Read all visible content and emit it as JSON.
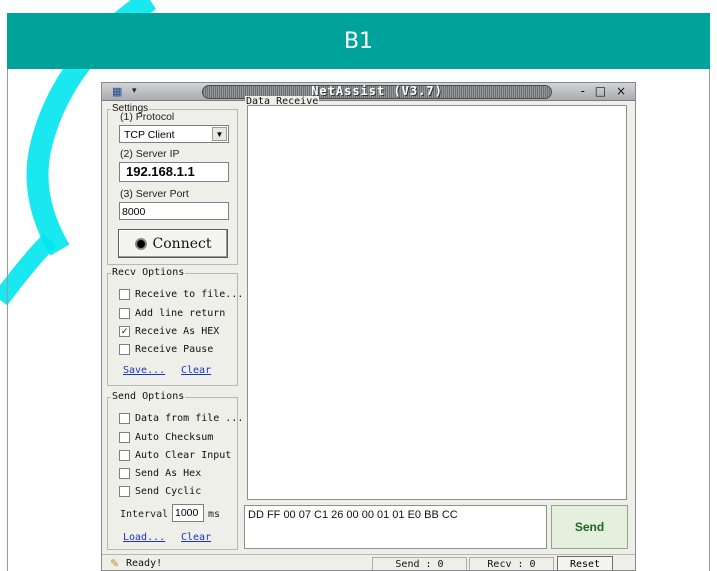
{
  "header": {
    "title": "B1"
  },
  "window": {
    "title": "NetAssist (V3.7)",
    "controls": "- □ ×"
  },
  "settings": {
    "group_title": "Settings",
    "protocol_label": "(1) Protocol",
    "protocol_value": "TCP Client",
    "server_ip_label": "(2) Server IP",
    "server_ip_value": "192.168.1.1",
    "server_port_label": "(3) Server Port",
    "server_port_value": "8000",
    "connect_label": "Connect"
  },
  "recv_options": {
    "group_title": "Recv Options",
    "items": [
      {
        "label": "Receive to file...",
        "checked": false
      },
      {
        "label": "Add line return",
        "checked": false
      },
      {
        "label": "Receive As HEX",
        "checked": true
      },
      {
        "label": "Receive Pause",
        "checked": false
      }
    ],
    "save_link": "Save...",
    "clear_link": "Clear"
  },
  "send_options": {
    "group_title": "Send Options",
    "items": [
      {
        "label": "Data from file ...",
        "checked": false
      },
      {
        "label": "Auto Checksum",
        "checked": false
      },
      {
        "label": "Auto Clear Input",
        "checked": false
      },
      {
        "label": "Send As Hex",
        "checked": false
      },
      {
        "label": "Send Cyclic",
        "checked": false
      }
    ],
    "interval_label": "Interval",
    "interval_value": "1000",
    "interval_unit": "ms",
    "load_link": "Load...",
    "clear_link": "Clear"
  },
  "data_receive": {
    "label": "Data Receive"
  },
  "send": {
    "input_value": "DD FF 00 07 C1 26 00 00 01 01 E0 BB CC",
    "button_label": "Send"
  },
  "status": {
    "ready": "Ready!",
    "send_count": "Send : 0",
    "recv_count": "Recv : 0",
    "reset_label": "Reset"
  },
  "colors": {
    "header_bg": "#00a39a",
    "watermark": "#00e5f0"
  }
}
